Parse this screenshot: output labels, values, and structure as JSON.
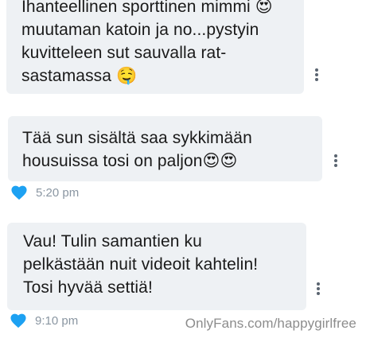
{
  "messages": [
    {
      "text": "Ihanteellinen sporttinen mimmi 😍\nmuutaman katoin ja no...pystyin\nkuvitteleen sut sauvalla rat-\nsastamassa 🤤"
    },
    {
      "text": "Tää sun sisältä saa sykkimään\nhousuissa tosi on paljon😍😍",
      "time": "5:20 pm",
      "liked": true
    },
    {
      "text": "Vau! Tulin samantien ku\npelkästään nuit videoit kahtelin!\nTosi hyvää settiä!",
      "time": "9:10 pm",
      "liked": true
    }
  ],
  "watermark": "OnlyFans.com/happygirlfree",
  "colors": {
    "bubble": "#eef1f4",
    "like_heart": "#1da1f2",
    "meta_text": "#8a96a2",
    "menu_dots": "#5a6470"
  },
  "icons": {
    "like": "heart-icon",
    "menu": "more-vertical-icon"
  }
}
